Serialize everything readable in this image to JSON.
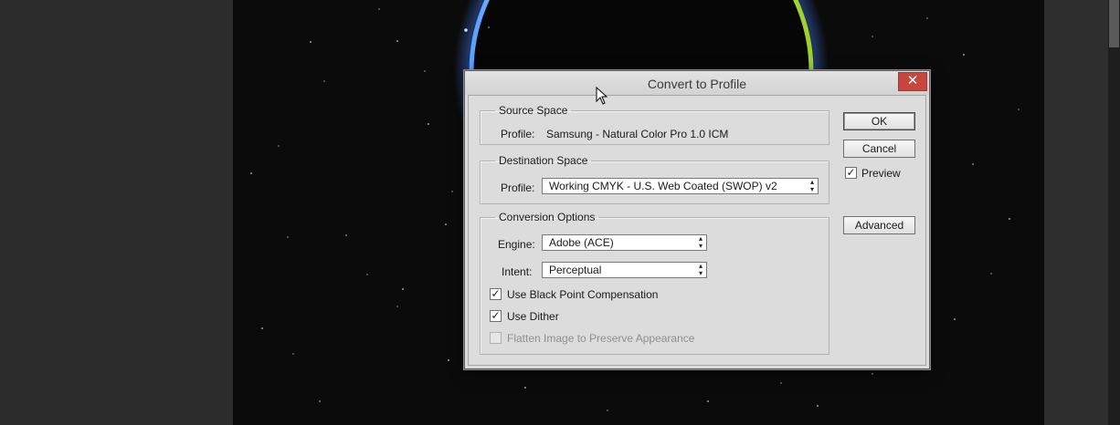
{
  "dialog": {
    "title": "Convert to Profile",
    "close_icon": "close-icon",
    "source_space": {
      "legend": "Source Space",
      "profile_label": "Profile:",
      "profile_value": "Samsung - Natural Color Pro 1.0 ICM"
    },
    "destination_space": {
      "legend": "Destination Space",
      "profile_label": "Profile:",
      "profile_selected": "Working CMYK - U.S. Web Coated (SWOP) v2"
    },
    "conversion_options": {
      "legend": "Conversion Options",
      "engine_label": "Engine:",
      "engine_selected": "Adobe (ACE)",
      "intent_label": "Intent:",
      "intent_selected": "Perceptual",
      "black_point_label": "Use Black Point Compensation",
      "black_point_checked": true,
      "dither_label": "Use Dither",
      "dither_checked": true,
      "flatten_label": "Flatten Image to Preserve Appearance",
      "flatten_checked": false,
      "flatten_enabled": false
    },
    "buttons": {
      "ok": "OK",
      "cancel": "Cancel",
      "advanced": "Advanced"
    },
    "preview_label": "Preview",
    "preview_checked": true
  },
  "colors": {
    "close_button": "#c7463e",
    "dialog_bg": "#dcdcdc",
    "canvas_bg": "#0b0b0c",
    "workspace_bg": "#2d2d2d"
  }
}
